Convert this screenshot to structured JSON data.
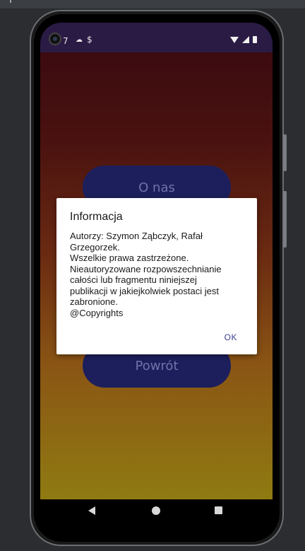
{
  "status_bar": {
    "time": "7",
    "left_icons": [
      "cloud-icon",
      "shield-icon"
    ],
    "right_icons": [
      "wifi-icon",
      "signal-icon",
      "battery-icon"
    ]
  },
  "app": {
    "buttons": {
      "about": "O nas",
      "back": "Powrót"
    }
  },
  "dialog": {
    "title": "Informacja",
    "body_lines": [
      "Autorzy: Szymon Ząbczyk, Rafał",
      "Grzegorzek.",
      "Wszelkie prawa zastrzeżone.",
      "Nieautoryzowane rozpowszechnianie",
      "całości lub fragmentu niniejszej",
      "publikacji w jakiejkolwiek postaci jest",
      "zabronione.",
      "@Copyrights"
    ],
    "ok_label": "OK"
  },
  "colors": {
    "status_bar": "#2a1b45",
    "button_bg": "#1d1f5c",
    "button_text": "#6f73a8",
    "dialog_accent": "#3b3f8f",
    "gradient_top": "#3c0b10",
    "gradient_bottom": "#8f7b12"
  }
}
